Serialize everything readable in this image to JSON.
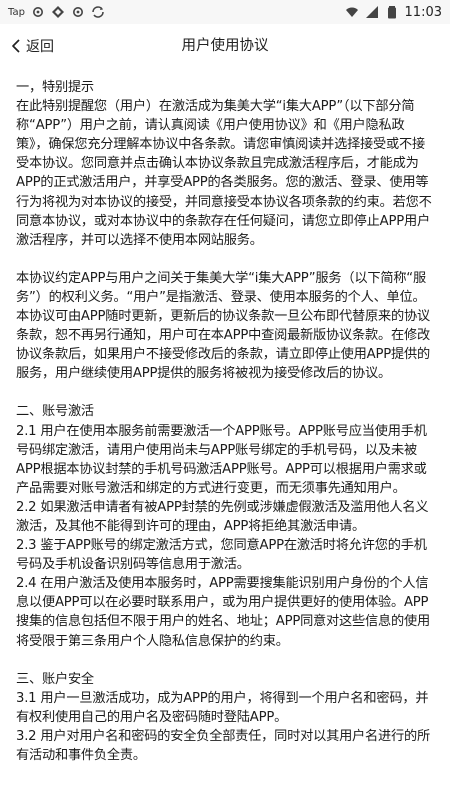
{
  "status_bar": {
    "carrier": "Tap",
    "icons": [
      "gear-icon",
      "diamond-icon",
      "gear-icon",
      "sync-icon",
      "wifi-icon",
      "signal-icon",
      "battery-icon"
    ],
    "time": "11:03"
  },
  "nav": {
    "back_label": "返回",
    "title": "用户使用协议"
  },
  "sections": [
    {
      "title": "一，特别提示",
      "paragraphs": [
        "在此特别提醒您（用户）在激活成为集美大学“i集大APP”（以下部分简称“APP”）用户之前，请认真阅读《用户使用协议》和《用户隐私政策》，确保您充分理解本协议中各条款。请您审慎阅读并选择接受或不接受本协议。您同意并点击确认本协议条款且完成激活程序后，才能成为APP的正式激活用户，并享受APP的各类服务。您的激活、登录、使用等行为将视为对本协议的接受，并同意接受本协议各项条款的约束。若您不同意本协议，或对本协议中的条款存在任何疑问，请您立即停止APP用户激活程序，并可以选择不使用本网站服务。"
      ]
    },
    {
      "title": "",
      "paragraphs": [
        "本协议约定APP与用户之间关于集美大学“i集大APP”服务（以下简称“服务”）的权利义务。“用户”是指激活、登录、使用本服务的个人、单位。本协议可由APP随时更新，更新后的协议条款一旦公布即代替原来的协议条款，恕不再另行通知，用户可在本APP中查阅最新版协议条款。在修改协议条款后，如果用户不接受修改后的条款，请立即停止使用APP提供的服务，用户继续使用APP提供的服务将被视为接受修改后的协议。"
      ]
    },
    {
      "title": "二、账号激活",
      "paragraphs": [
        "2.1 用户在使用本服务前需要激活一个APP账号。APP账号应当使用手机号码绑定激活，请用户使用尚未与APP账号绑定的手机号码，以及未被APP根据本协议封禁的手机号码激活APP账号。APP可以根据用户需求或产品需要对账号激活和绑定的方式进行变更，而无须事先通知用户。",
        "2.2 如果激活申请者有被APP封禁的先例或涉嫌虚假激活及滥用他人名义激活，及其他不能得到许可的理由，APP将拒绝其激活申请。",
        "2.3 鉴于APP账号的绑定激活方式，您同意APP在激活时将允许您的手机号码及手机设备识别码等信息用于激活。",
        "2.4 在用户激活及使用本服务时，APP需要搜集能识别用户身份的个人信息以便APP可以在必要时联系用户，或为用户提供更好的使用体验。APP搜集的信息包括但不限于用户的姓名、地址；APP同意对这些信息的使用将受限于第三条用户个人隐私信息保护的约束。"
      ]
    },
    {
      "title": "三、账户安全",
      "paragraphs": [
        "3.1 用户一旦激活成功，成为APP的用户，将得到一个用户名和密码，并有权利使用自己的用户名及密码随时登陆APP。",
        "3.2 用户对用户名和密码的安全负全部责任，同时对以其用户名进行的所有活动和事件负全责。"
      ]
    }
  ]
}
